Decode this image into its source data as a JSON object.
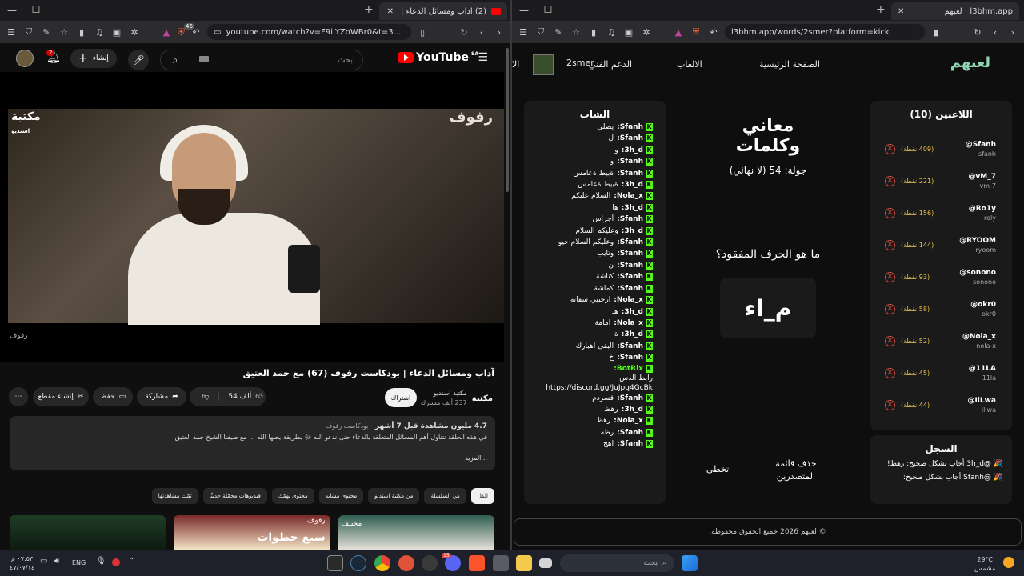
{
  "left_browser": {
    "tab_title": "(2) آداب ومسائل الدعاء | بودكاست",
    "url": "youtube.com/watch?v=F9iiYZoWBr0&t=3...",
    "badge_count": "46"
  },
  "youtube": {
    "logo_text": "YouTube",
    "region": "SA",
    "search_placeholder": "بحث",
    "create_label": "إنشاء",
    "notif_count": "2",
    "video_overlay_title": "رفوف",
    "video_overlay_logo": "مكتبة",
    "video_overlay_logo_sub": "استديو",
    "video_watermark": "رفوف",
    "video_title": "آداب ومسائل الدعاء | بودكاست رفوف (67) مع حمد العتيق",
    "channel_name": "مكتبة استديو",
    "channel_subs": "237 ألف مشترك",
    "channel_logo": "مكتبة",
    "subscribe_label": "اشتراك",
    "like_count": "54 ألف",
    "share_label": "مشاركة",
    "save_label": "حفظ",
    "clip_label": "إنشاء مقطع",
    "desc_stats": "4.7 مليون مشاهدة  قبل 7 أشهر",
    "desc_tag": "بودكاست رفوف",
    "desc_text": "في هذه الحلقة نتناول أهم المسائل المتعلقة بالدعاء حتى ندعو الله ﷻ بطريقة يحبها الله ... مع ضيفنا الشيخ حمد العتيق",
    "desc_more": "...المزيد",
    "chips": [
      "الكل",
      "من السلسلة",
      "من مكتبة استديو",
      "محتوى مشابه",
      "محتوى يهمّك",
      "فيديوهات محمّلة حديثًا",
      "تمّت مشاهدتها"
    ],
    "thumb_texts": [
      "مختلف",
      "رفوف",
      "سبع خطوات"
    ]
  },
  "right_browser": {
    "tab_title": "l3bhm.app | لعبهم",
    "url": "l3bhm.app/words/2smer?platform=kick"
  },
  "site": {
    "logo": "لعبهم",
    "nav": [
      "الصفحة الرئيسية",
      "الالعاب",
      "الدعم الفني",
      "2smer",
      "الا"
    ],
    "players_title": "اللاعبين (10)",
    "players": [
      {
        "name": "@Sfanh",
        "sub": "sfanh",
        "points": "(409 نقطة)"
      },
      {
        "name": "@vM_7",
        "sub": "vm-7",
        "points": "(221 نقطة)"
      },
      {
        "name": "@Ro1y",
        "sub": "roly",
        "points": "(156 نقطة)"
      },
      {
        "name": "@RYOOM",
        "sub": "ryoom",
        "points": "(144 نقطة)"
      },
      {
        "name": "@sonono",
        "sub": "sonono",
        "points": "(93 نقطة)"
      },
      {
        "name": "@okr0",
        "sub": "okr0",
        "points": "(58 نقطة)"
      },
      {
        "name": "@Nola_x",
        "sub": "nola-x",
        "points": "(52 نقطة)"
      },
      {
        "name": "@11LA",
        "sub": "11la",
        "points": "(45 نقطة)"
      },
      {
        "name": "@IlLwa",
        "sub": "illwa",
        "points": "(44 نقطة)"
      }
    ],
    "log_title": "السجل",
    "log": [
      "🎉 @3h_d أجاب بشكل صحيح: رهظ!",
      "🎉 @Sfanh أجاب بشكل صحيح:"
    ],
    "game_title": "معاني وكلمات",
    "round": "جولة: 54 (لا نهائي)",
    "question": "ما هو الحرف المفقود؟",
    "puzzle": "م_اء",
    "clear_leaders": "حذف قائمة المتصدرين",
    "skip": "تخطي",
    "chat_title": "الشات",
    "chat": [
      {
        "user": "Sfanh:",
        "msg": "يصلي"
      },
      {
        "user": "Sfanh:",
        "msg": "ل"
      },
      {
        "user": "3h_d:",
        "msg": "و"
      },
      {
        "user": "Sfanh:",
        "msg": "و"
      },
      {
        "user": "Sfanh:",
        "msg": "ةبيط ةعامس"
      },
      {
        "user": "3h_d:",
        "msg": "ةبيط ةعامس"
      },
      {
        "user": "Nola_x:",
        "msg": "السلام عليكم"
      },
      {
        "user": "3h_d:",
        "msg": "ها"
      },
      {
        "user": "Sfanh:",
        "msg": "أجراس"
      },
      {
        "user": "3h_d:",
        "msg": "وعليكم السلام"
      },
      {
        "user": "Sfanh:",
        "msg": "وعليكم السلام حيو"
      },
      {
        "user": "Sfanh:",
        "msg": "وتايب"
      },
      {
        "user": "Sfanh:",
        "msg": "ن"
      },
      {
        "user": "Sfanh:",
        "msg": "كناشة"
      },
      {
        "user": "Sfanh:",
        "msg": "كماشة"
      },
      {
        "user": "Nola_x:",
        "msg": "ارحبيي سفانه"
      },
      {
        "user": "3h_d:",
        "msg": "هـ"
      },
      {
        "user": "Nola_x:",
        "msg": "امامة"
      },
      {
        "user": "3h_d:",
        "msg": "ة"
      },
      {
        "user": "Sfanh:",
        "msg": "البقى اهبارك"
      },
      {
        "user": "Sfanh:",
        "msg": "خ"
      },
      {
        "user": "BotRix:",
        "msg": "رابط الدس https://discord.gg/JuJpq4GcBk"
      },
      {
        "user": "Sfanh:",
        "msg": "قسردم"
      },
      {
        "user": "3h_d:",
        "msg": "رهظ"
      },
      {
        "user": "Nola_x:",
        "msg": "رهظ"
      },
      {
        "user": "Sfanh:",
        "msg": "رظه"
      },
      {
        "user": "Sfanh:",
        "msg": "اهخ"
      }
    ],
    "footer": "© لعبهم 2026 جميع الحقوق محفوظة."
  },
  "taskbar": {
    "search_placeholder": "بحث",
    "weather_temp": "29°C",
    "weather_desc": "مشمس",
    "lang": "ENG",
    "time": "٠٧:٥٣ م",
    "date": "٤٧/٠٧/١٤",
    "discord_badge": "15"
  }
}
